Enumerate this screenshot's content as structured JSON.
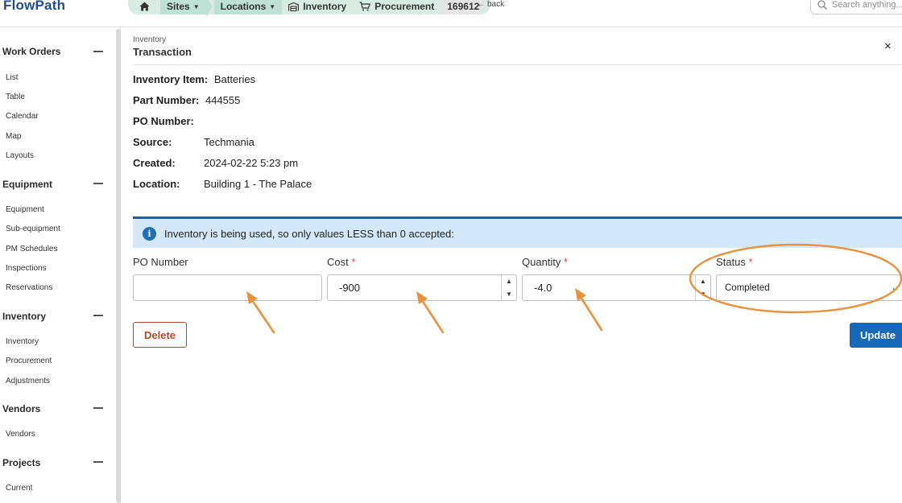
{
  "app": {
    "name": "FlowPath"
  },
  "breadcrumb": {
    "items": [
      {
        "label": "Sites",
        "dropdown": true
      },
      {
        "label": "Locations",
        "dropdown": true
      },
      {
        "label": "Inventory"
      },
      {
        "label": "Procurement"
      }
    ],
    "record_id": "169612"
  },
  "back": {
    "label": "back"
  },
  "search": {
    "placeholder": "Search anything..."
  },
  "sidebar": {
    "sections": [
      {
        "title": "Work Orders",
        "items": [
          "List",
          "Table",
          "Calendar",
          "Map",
          "Layouts"
        ]
      },
      {
        "title": "Equipment",
        "items": [
          "Equipment",
          "Sub-equipment",
          "PM Schedules",
          "Inspections",
          "Reservations"
        ]
      },
      {
        "title": "Inventory",
        "items": [
          "Inventory",
          "Procurement",
          "Adjustments"
        ]
      },
      {
        "title": "Vendors",
        "items": [
          "Vendors"
        ]
      },
      {
        "title": "Projects",
        "items": [
          "Current"
        ]
      }
    ]
  },
  "panel": {
    "kicker": "Inventory",
    "title": "Transaction",
    "close": "×"
  },
  "details": {
    "inventory_item": {
      "label": "Inventory Item:",
      "value": "Batteries"
    },
    "part_number": {
      "label": "Part Number:",
      "value": "444555"
    },
    "po_number": {
      "label": "PO Number:",
      "value": ""
    },
    "source": {
      "label": "Source:",
      "value": "Techmania"
    },
    "created": {
      "label": "Created:",
      "value": "2024-02-22 5:23 pm"
    },
    "location": {
      "label": "Location:",
      "value": "Building 1 - The Palace"
    }
  },
  "alert": {
    "icon": "info-icon",
    "text": "Inventory is being used, so only values LESS than 0 accepted:"
  },
  "form": {
    "po_number": {
      "label": "PO Number",
      "value": ""
    },
    "cost": {
      "label": "Cost",
      "required": "*",
      "value": "-900"
    },
    "quantity": {
      "label": "Quantity",
      "required": "*",
      "value": "-4.0"
    },
    "status": {
      "label": "Status",
      "required": "*",
      "value": "Completed"
    }
  },
  "actions": {
    "delete": "Delete",
    "update": "Update"
  },
  "colors": {
    "accent": "#1568b8",
    "annotation": "#e8913e",
    "alert_bg": "#d3e8f8",
    "delete": "#b14a2a",
    "logo": "#1f4e8c"
  }
}
